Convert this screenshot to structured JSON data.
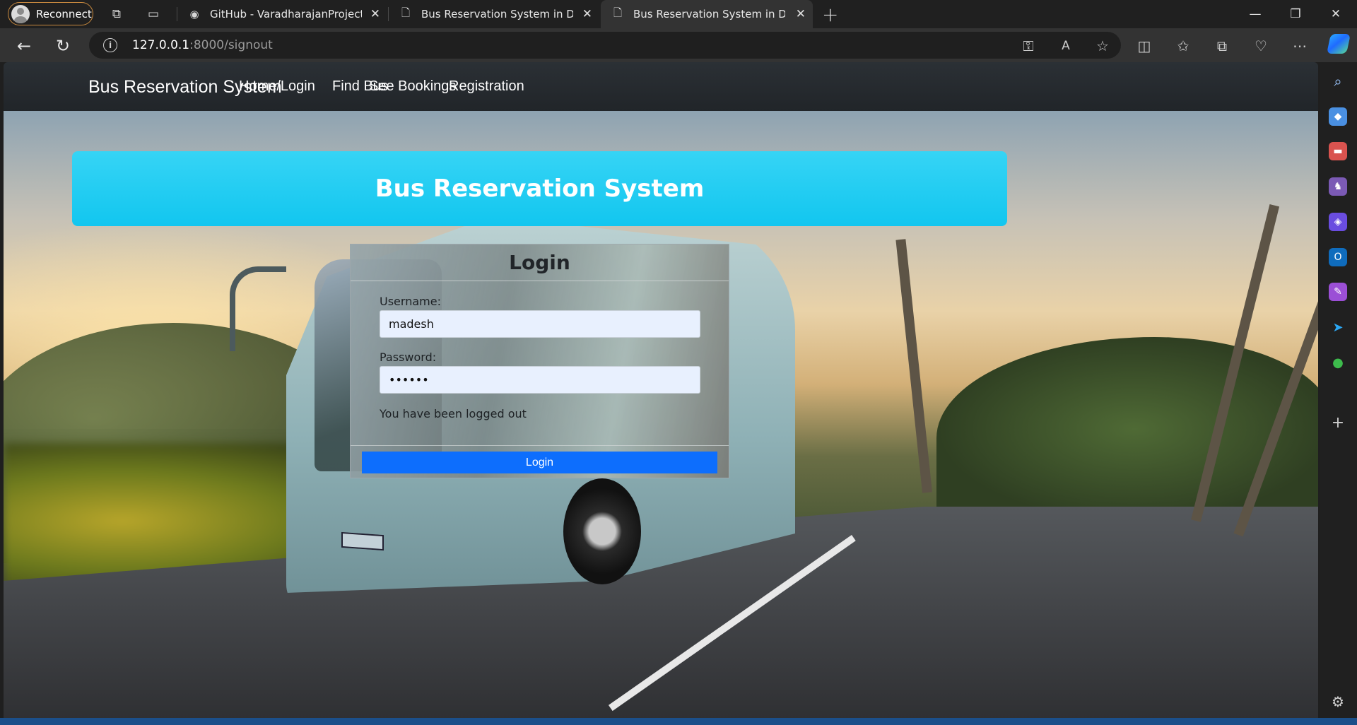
{
  "browser": {
    "profile_label": "Reconnect",
    "tabs": [
      {
        "title": "GitHub - VaradharajanProjects/N",
        "favicon": "github-icon",
        "active": false
      },
      {
        "title": "Bus Reservation System in Djang",
        "favicon": "document-icon",
        "active": false
      },
      {
        "title": "Bus Reservation System in Djang",
        "favicon": "document-icon",
        "active": true
      }
    ],
    "url_host": "127.0.0.1",
    "url_path": ":8000/signout"
  },
  "site": {
    "brand": "Bus Reservation System",
    "nav": [
      {
        "label": "Home/Login"
      },
      {
        "label": "Find Bus"
      },
      {
        "label": "See Bookings"
      },
      {
        "label": "Registration"
      }
    ],
    "banner_title": "Bus Reservation System"
  },
  "login": {
    "title": "Login",
    "username_label": "Username:",
    "username_value": "madesh",
    "password_label": "Password:",
    "password_value": "••••••",
    "message": "You have been logged out",
    "submit_label": "Login"
  },
  "colors": {
    "banner": "#1ccaf0",
    "login_button": "#0d6efd",
    "navbar": "#212529"
  }
}
